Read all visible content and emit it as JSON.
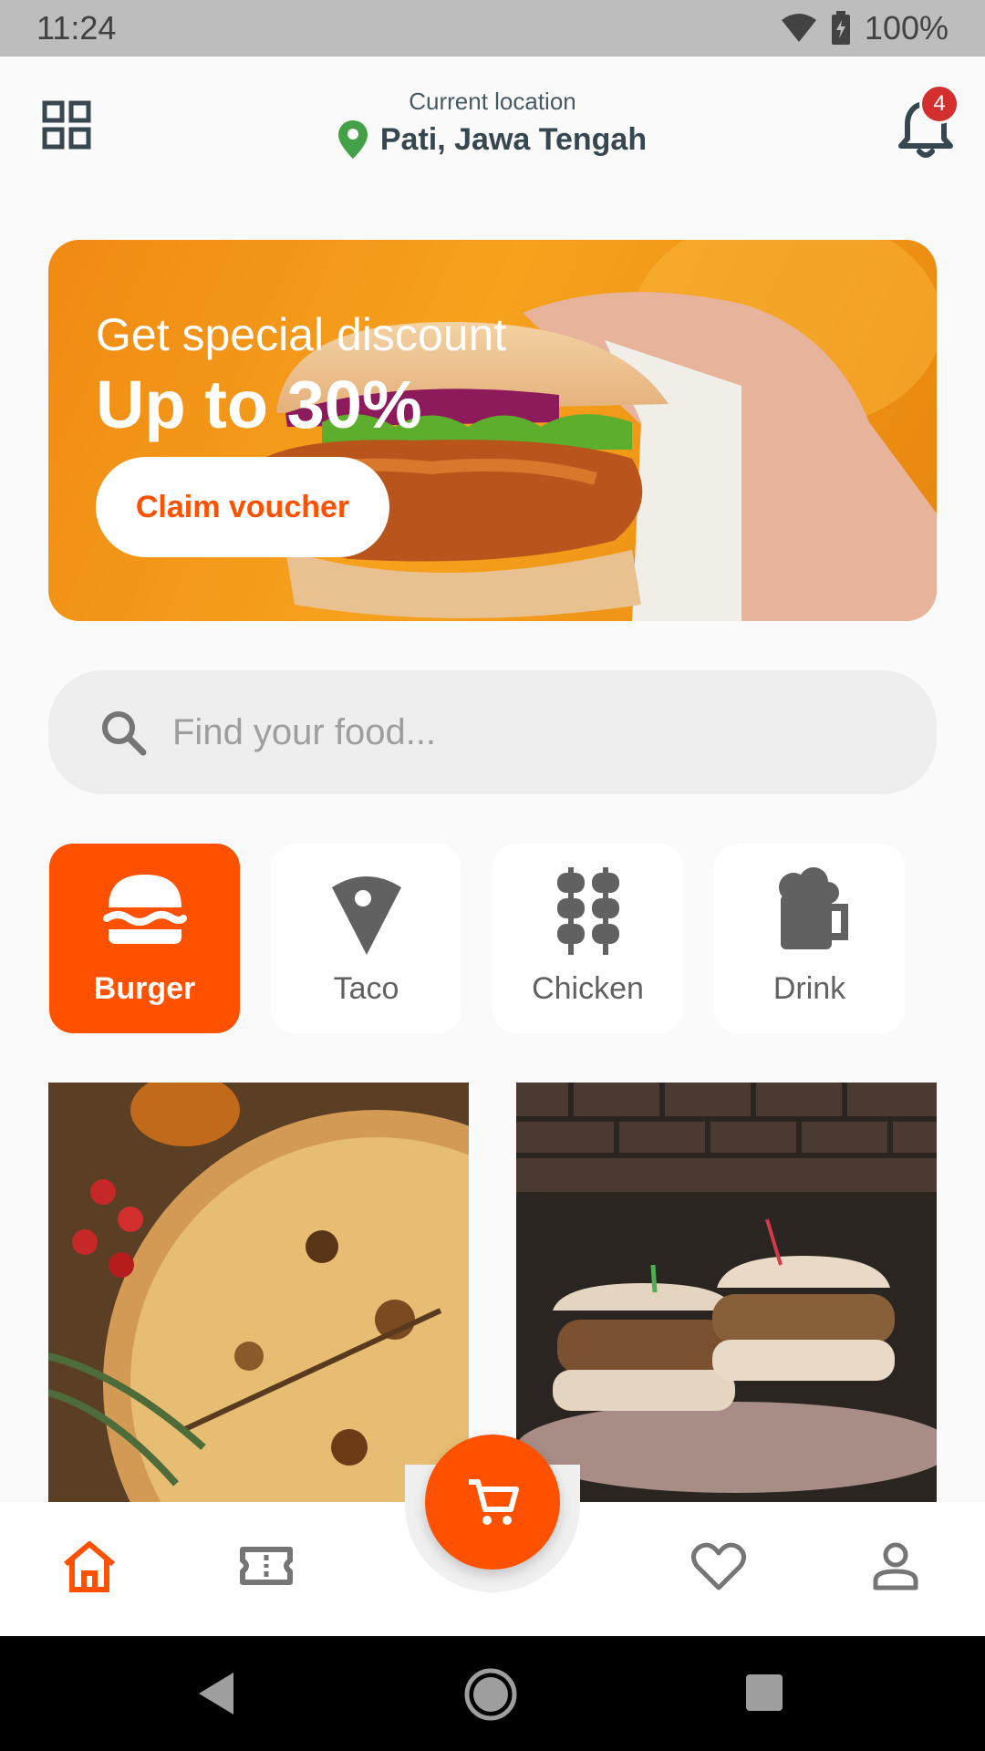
{
  "status_bar": {
    "time": "11:24",
    "battery": "100%"
  },
  "header": {
    "caption": "Current location",
    "location": "Pati, Jawa Tengah",
    "notification_count": "4"
  },
  "banner": {
    "subtitle": "Get special discount",
    "title": "Up to 30%",
    "button_label": "Claim voucher"
  },
  "search": {
    "placeholder": "Find your food..."
  },
  "categories": [
    {
      "label": "Burger",
      "icon": "burger-icon",
      "selected": true
    },
    {
      "label": "Taco",
      "icon": "taco-icon",
      "selected": false
    },
    {
      "label": "Chicken",
      "icon": "skewer-icon",
      "selected": false
    },
    {
      "label": "Drink",
      "icon": "beer-mug-icon",
      "selected": false
    }
  ],
  "food_cards": [
    {
      "image": "pizza-photo"
    },
    {
      "image": "burgers-photo"
    }
  ],
  "bottom_nav": {
    "items": [
      "home-icon",
      "voucher-icon",
      "cart-icon",
      "heart-icon",
      "profile-icon"
    ],
    "active": "home-icon"
  },
  "colors": {
    "accent": "#ff5100",
    "badge": "#d32f2f",
    "location_pin": "#43a047",
    "banner": "#f6a21d"
  }
}
